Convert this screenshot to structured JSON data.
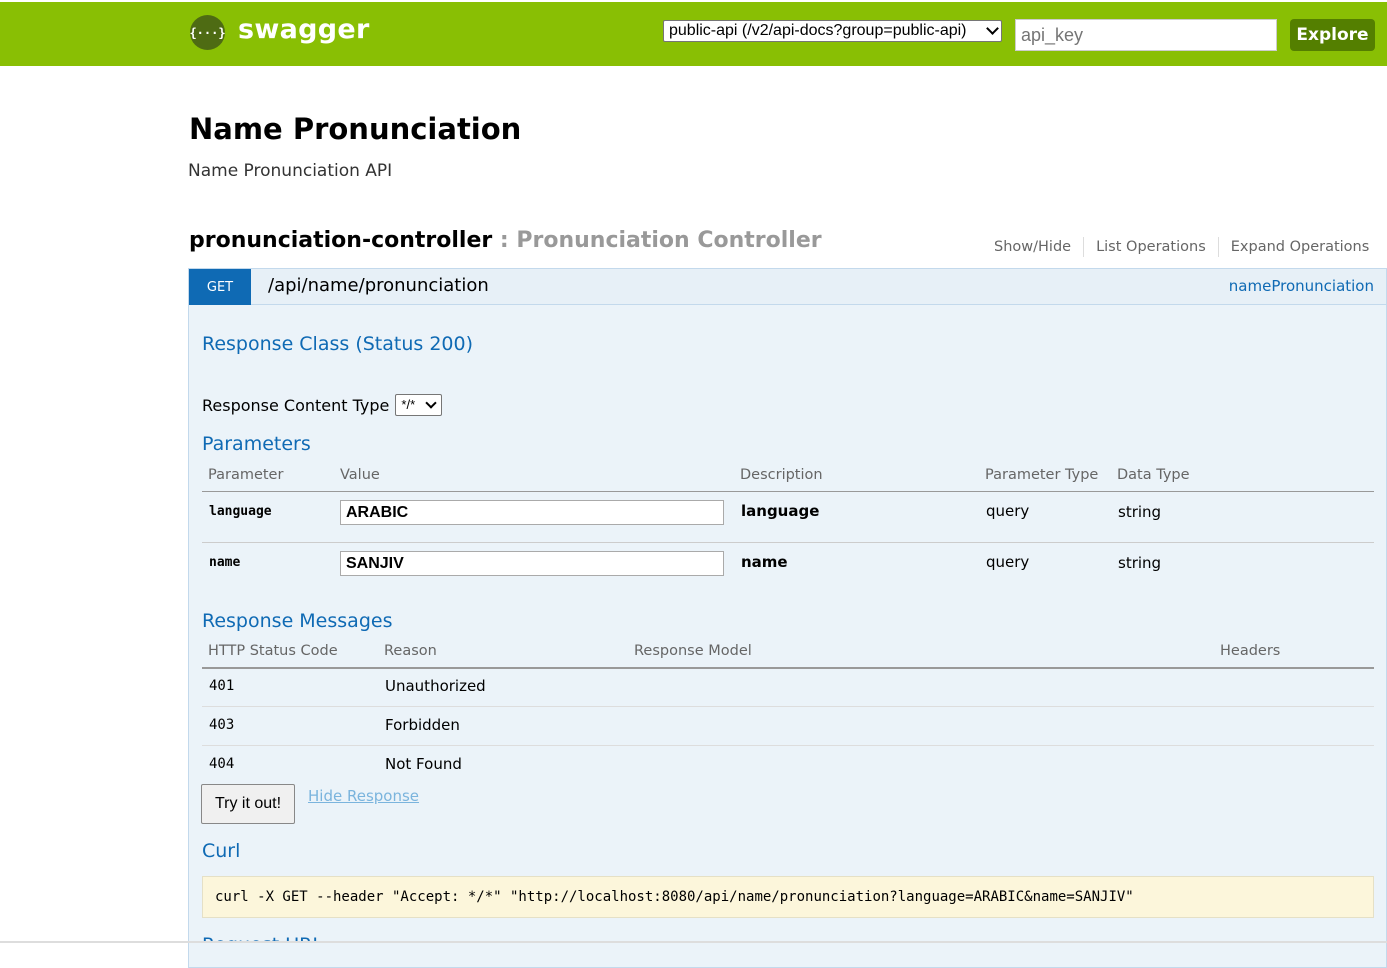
{
  "header": {
    "logo_glyph": "{···}",
    "logo_text": "swagger",
    "api_select_value": "public-api (/v2/api-docs?group=public-api)",
    "api_key_placeholder": "api_key",
    "explore_label": "Explore"
  },
  "info": {
    "title": "Name Pronunciation",
    "description": "Name Pronunciation API"
  },
  "resource": {
    "name": "pronunciation-controller",
    "description": " : Pronunciation Controller",
    "links": [
      "Show/Hide",
      "List Operations",
      "Expand Operations"
    ]
  },
  "operation": {
    "method": "GET",
    "path": "/api/name/pronunciation",
    "nickname": "namePronunciation",
    "response_class_title": "Response Class (Status 200)",
    "content_type_label": "Response Content Type",
    "content_type_value": "*/*",
    "parameters_title": "Parameters",
    "param_headers": [
      "Parameter",
      "Value",
      "Description",
      "Parameter Type",
      "Data Type"
    ],
    "params": [
      {
        "name": "language",
        "value": "ARABIC",
        "description": "language",
        "param_type": "query",
        "data_type": "string"
      },
      {
        "name": "name",
        "value": "SANJIV",
        "description": "name",
        "param_type": "query",
        "data_type": "string"
      }
    ],
    "messages_title": "Response Messages",
    "message_headers": [
      "HTTP Status Code",
      "Reason",
      "Response Model",
      "Headers"
    ],
    "messages": [
      {
        "code": "401",
        "reason": "Unauthorized"
      },
      {
        "code": "403",
        "reason": "Forbidden"
      },
      {
        "code": "404",
        "reason": "Not Found"
      }
    ],
    "try_label": "Try it out!",
    "hide_response_label": "Hide Response",
    "curl_title": "Curl",
    "curl_command": "curl -X GET --header \"Accept: */*\" \"http://localhost:8080/api/name/pronunciation?language=ARABIC&name=SANJIV\"",
    "request_url_title": "Request URL"
  },
  "colors": {
    "header_bg": "#89bf04",
    "explore_bg": "#547f00",
    "get_badge": "#0f6ab4",
    "op_bg": "#ebf3f9",
    "curl_bg": "#fcf6db"
  }
}
